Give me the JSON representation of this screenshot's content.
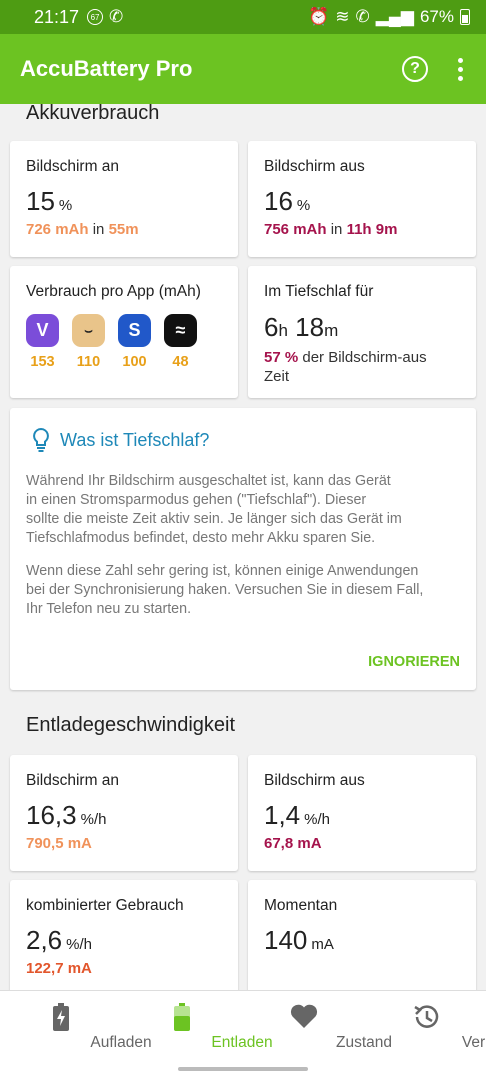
{
  "status": {
    "time": "21:17",
    "notif_badge": "67",
    "battery": "67%"
  },
  "app": {
    "title": "AccuBattery Pro"
  },
  "usage": {
    "title": "Akkuverbrauch",
    "screen_on": {
      "label": "Bildschirm an",
      "value": "15",
      "unit": "%",
      "mah": "726 mAh",
      "in": "in",
      "duration": "55m"
    },
    "screen_off": {
      "label": "Bildschirm aus",
      "value": "16",
      "unit": "%",
      "mah": "756 mAh",
      "in": "in",
      "duration": "11h 9m"
    },
    "per_app": {
      "label": "Verbrauch pro App (mAh)",
      "apps": [
        {
          "icon": "viber-icon",
          "value": "153",
          "color": "#7b4dd9"
        },
        {
          "icon": "amazon-icon",
          "value": "110",
          "color": "#e9c48a"
        },
        {
          "icon": "samsung-app-icon",
          "value": "100",
          "color": "#2158c9"
        },
        {
          "icon": "waves-app-icon",
          "value": "48",
          "color": "#111111"
        }
      ]
    },
    "deep_sleep": {
      "label": "Im Tiefschlaf für",
      "hours": "6",
      "h": "h",
      "minutes": "18",
      "m": "m",
      "percent": "57 %",
      "rest_line1": "der Bildschirm-aus",
      "rest_line2": "Zeit"
    }
  },
  "info": {
    "title": "Was ist Tiefschlaf?",
    "p1": [
      "Während Ihr Bildschirm ausgeschaltet ist, kann das Gerät",
      "in einen Stromsparmodus gehen (\"Tiefschlaf\"). Dieser",
      "sollte die meiste Zeit aktiv sein. Je länger sich das Gerät im",
      "Tiefschlafmodus befindet, desto mehr Akku sparen Sie."
    ],
    "p2": [
      "Wenn diese Zahl sehr gering ist, können einige Anwendungen",
      "bei der Synchronisierung haken. Versuchen Sie in diesem Fall,",
      "Ihr Telefon neu zu starten."
    ],
    "ignore": "IGNORIEREN"
  },
  "discharge": {
    "title": "Entladegeschwindigkeit",
    "screen_on": {
      "label": "Bildschirm an",
      "value": "16,3",
      "unit": "%/h",
      "ma": "790,5 mA"
    },
    "screen_off": {
      "label": "Bildschirm aus",
      "value": "1,4",
      "unit": "%/h",
      "ma": "67,8 mA"
    },
    "combined": {
      "label": "kombinierter Gebrauch",
      "value": "2,6",
      "unit": "%/h",
      "ma": "122,7 mA"
    },
    "current": {
      "label": "Momentan",
      "value": "140",
      "unit": "mA"
    }
  },
  "nav": [
    {
      "label": "Aufladen",
      "icon": "battery-charging-icon",
      "active": false
    },
    {
      "label": "Entladen",
      "icon": "battery-discharging-icon",
      "active": true
    },
    {
      "label": "Zustand",
      "icon": "heart-icon",
      "active": false
    },
    {
      "label": "Verlauf",
      "icon": "history-icon",
      "active": false
    }
  ],
  "colors": {
    "appbar": "#6cc322",
    "statusbar": "#4e9c13",
    "accent_green": "#6cc322",
    "orange": "#f0925a",
    "maroon": "#a5134c",
    "info_blue": "#1e88b8",
    "app_value": "#e8a019"
  }
}
